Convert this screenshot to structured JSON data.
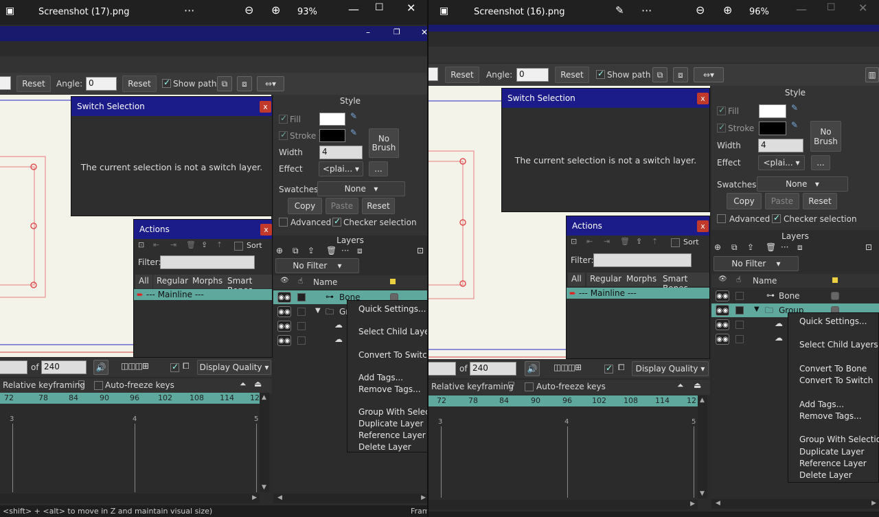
{
  "left": {
    "window_title": "Screenshot (17).png",
    "zoom": "93%",
    "toolbar": {
      "reset1": "Reset",
      "angle_label": "Angle:",
      "angle_value": "0",
      "reset2": "Reset",
      "show_path": "Show path"
    },
    "switch_dialog": {
      "title": "Switch Selection",
      "close": "x",
      "message": "The current selection is not a switch layer."
    },
    "style": {
      "header": "Style",
      "fill": "Fill",
      "stroke": "Stroke",
      "width_label": "Width",
      "width_value": "4",
      "effect_label": "Effect",
      "effect_value": "<plai...",
      "effect_more": "...",
      "no_brush": "No Brush",
      "swatches_label": "Swatches",
      "swatches_value": "None",
      "copy": "Copy",
      "paste": "Paste",
      "reset": "Reset",
      "advanced": "Advanced",
      "checker": "Checker selection"
    },
    "actions": {
      "title": "Actions",
      "close": "x",
      "sort": "Sort",
      "filter_label": "Filter:",
      "tabs": [
        "All",
        "Regular",
        "Morphs",
        "Smart Bones"
      ],
      "mainline": "--- Mainline ---"
    },
    "layers": {
      "header": "Layers",
      "filter": "No Filter",
      "name_col": "Name",
      "bone": "Bone",
      "group": "Gr"
    },
    "context_menu": [
      "Quick Settings...",
      "Select Child Layers",
      "Convert To Switch",
      "Add Tags...",
      "Remove Tags...",
      "Group With Selection",
      "Duplicate Layer",
      "Reference Layer",
      "Delete Layer"
    ],
    "timeline": {
      "of_label": "of",
      "end_frame": "240",
      "display_quality": "Display Quality",
      "relative_keyframing": "Relative keyframing",
      "auto_freeze": "Auto-freeze keys",
      "ruler": [
        "72",
        "78",
        "84",
        "90",
        "96",
        "102",
        "108",
        "114",
        "12"
      ],
      "markers": [
        "3",
        "4",
        "5"
      ]
    },
    "status": "<shift> + <alt> to move in Z and maintain visual size)",
    "status_right": "Fram"
  },
  "right": {
    "window_title": "Screenshot (16).png",
    "zoom": "96%",
    "toolbar": {
      "reset1": "Reset",
      "angle_label": "Angle:",
      "angle_value": "0",
      "reset2": "Reset",
      "show_path": "Show path"
    },
    "switch_dialog": {
      "title": "Switch Selection",
      "close": "x",
      "message": "The current selection is not a switch layer."
    },
    "style": {
      "header": "Style",
      "fill": "Fill",
      "stroke": "Stroke",
      "width_label": "Width",
      "width_value": "4",
      "effect_label": "Effect",
      "effect_value": "<plai...",
      "effect_more": "...",
      "no_brush": "No Brush",
      "swatches_label": "Swatches",
      "swatches_value": "None",
      "copy": "Copy",
      "paste": "Paste",
      "reset": "Reset",
      "advanced": "Advanced",
      "checker": "Checker selection"
    },
    "actions": {
      "title": "Actions",
      "close": "x",
      "sort": "Sort",
      "filter_label": "Filter:",
      "tabs": [
        "All",
        "Regular",
        "Morphs",
        "Smart Bones"
      ],
      "mainline": "--- Mainline ---"
    },
    "layers": {
      "header": "Layers",
      "filter": "No Filter",
      "name_col": "Name",
      "bone": "Bone",
      "group": "Group"
    },
    "context_menu": [
      "Quick Settings...",
      "Select Child Layers",
      "Convert To Bone",
      "Convert To Switch",
      "Add Tags...",
      "Remove Tags...",
      "Group With Selection",
      "Duplicate Layer",
      "Reference Layer",
      "Delete Layer"
    ],
    "timeline": {
      "of_label": "of",
      "end_frame": "240",
      "display_quality": "Display Quality",
      "relative_keyframing": "Relative keyframing",
      "auto_freeze": "Auto-freeze keys",
      "ruler": [
        "72",
        "78",
        "84",
        "90",
        "96",
        "102",
        "108",
        "114",
        "12"
      ],
      "markers": [
        "3",
        "4",
        "5"
      ]
    }
  },
  "colors": {
    "titlebar": "#202020",
    "dialog_head": "#1b1b8a",
    "close_red": "#c0392b",
    "teal": "#5fa89e",
    "canvas": "#f4f3ea"
  }
}
